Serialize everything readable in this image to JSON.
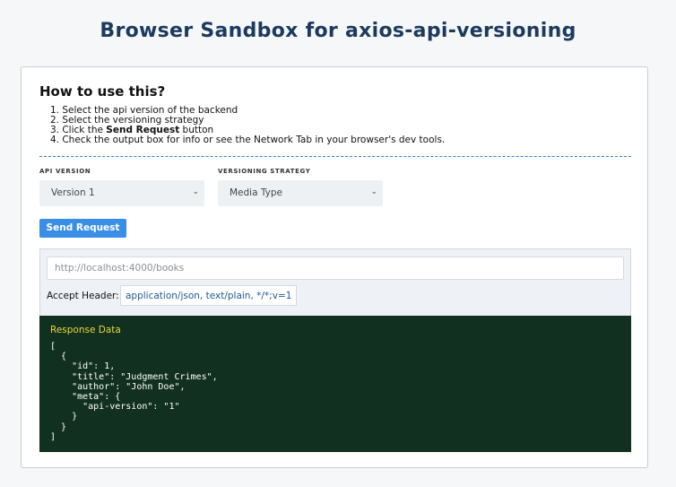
{
  "page": {
    "title": "Browser Sandbox for axios-api-versioning"
  },
  "instructions": {
    "heading": "How to use this?",
    "step1": "1. Select the api version of the backend",
    "step2": "2. Select the versioning strategy",
    "step3_prefix": "3. Click the ",
    "step3_bold": "Send Request",
    "step3_suffix": " button",
    "step4": "4. Check the output box for info or see the Network Tab in your browser's dev tools."
  },
  "controls": {
    "api_version_label": "API VERSION",
    "api_version_value": "Version 1",
    "strategy_label": "VERSIONING STRATEGY",
    "strategy_value": "Media Type",
    "send_button": "Send Request"
  },
  "request": {
    "url_placeholder": "http://localhost:4000/books",
    "accept_label": "Accept Header:",
    "accept_value": "application/json, text/plain, */*;v=1"
  },
  "response": {
    "title": "Response Data",
    "body": "[\n  {\n    \"id\": 1,\n    \"title\": \"Judgment Crimes\",\n    \"author\": \"John Doe\",\n    \"meta\": {\n      \"api-version\": \"1\"\n    }\n  }\n]"
  },
  "icons": {
    "select_chevron": "chevron-down-icon"
  },
  "colors": {
    "title": "#1c3a5e",
    "button": "#3a8ee6",
    "response_bg": "#12301f",
    "response_title": "#e8d93a",
    "divider": "#3b7fbf"
  }
}
